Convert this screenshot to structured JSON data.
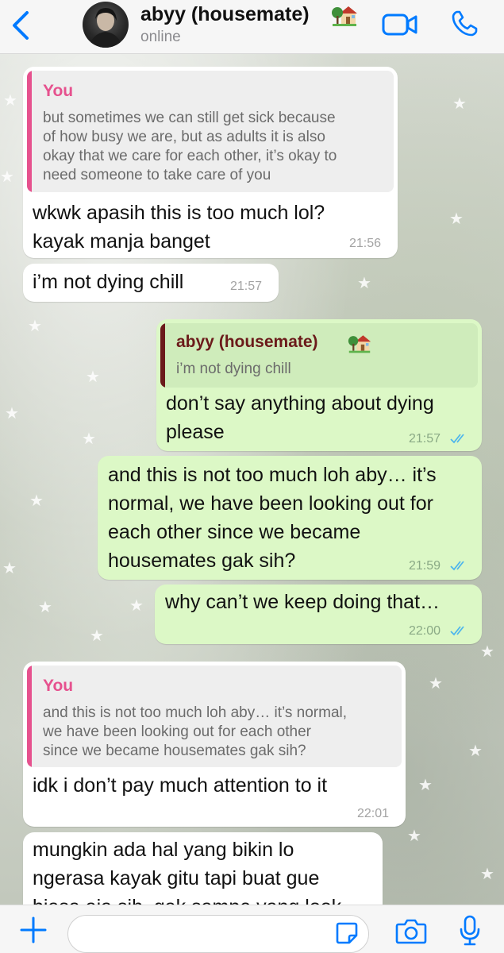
{
  "header": {
    "contact_name": "abyy (housemate)",
    "contact_emoji": "house-with-garden",
    "status": "online"
  },
  "messages": [
    {
      "direction": "incoming",
      "quote": {
        "author": "You",
        "lines": [
          "but sometimes we can still get sick because",
          "of how busy we are, but  as adults it is also",
          "okay that we care for each other, it’s okay to",
          "need someone to take care of you"
        ]
      },
      "lines": [
        "wkwk apasih this is too much lol?",
        "kayak manja banget"
      ],
      "time": "21:56"
    },
    {
      "direction": "incoming",
      "lines": [
        "i’m not dying chill"
      ],
      "time": "21:57"
    },
    {
      "direction": "outgoing",
      "quote": {
        "author": "abyy (housemate)",
        "lines": [
          "i’m not dying chill"
        ]
      },
      "lines": [
        "don’t say anything about dying",
        "please"
      ],
      "time": "21:57",
      "read": true
    },
    {
      "direction": "outgoing",
      "lines": [
        "and this is not too much loh aby… it’s",
        "normal, we have been looking out for",
        "each other since we became",
        "housemates gak sih?"
      ],
      "time": "21:59",
      "read": true
    },
    {
      "direction": "outgoing",
      "lines": [
        "why can’t we keep doing that…"
      ],
      "time": "22:00",
      "read": true
    },
    {
      "direction": "incoming",
      "quote": {
        "author": "You",
        "lines": [
          "and this is not too much loh aby… it’s normal,",
          "we have been looking out for each other",
          "since we became housemates gak sih?"
        ]
      },
      "lines": [
        "idk i don’t pay much attention to it"
      ],
      "time": "22:01"
    },
    {
      "direction": "incoming",
      "lines": [
        "mungkin ada hal yang bikin lo",
        "ngerasa kayak gitu tapi buat gue",
        "biasa aja sih, gak sampe yang look"
      ],
      "time": ""
    }
  ],
  "input": {
    "placeholder": ""
  },
  "colors": {
    "accent": "#007aff",
    "you_quote": "#e6518e",
    "contact_quote": "#6b1a1a",
    "outgoing_bubble": "#dcf8c6",
    "incoming_bubble": "#ffffff",
    "read_ticks": "#4fb6ec"
  },
  "icons": [
    "back-chevron-icon",
    "video-call-icon",
    "phone-icon",
    "plus-icon",
    "sticker-icon",
    "camera-icon",
    "microphone-icon"
  ]
}
